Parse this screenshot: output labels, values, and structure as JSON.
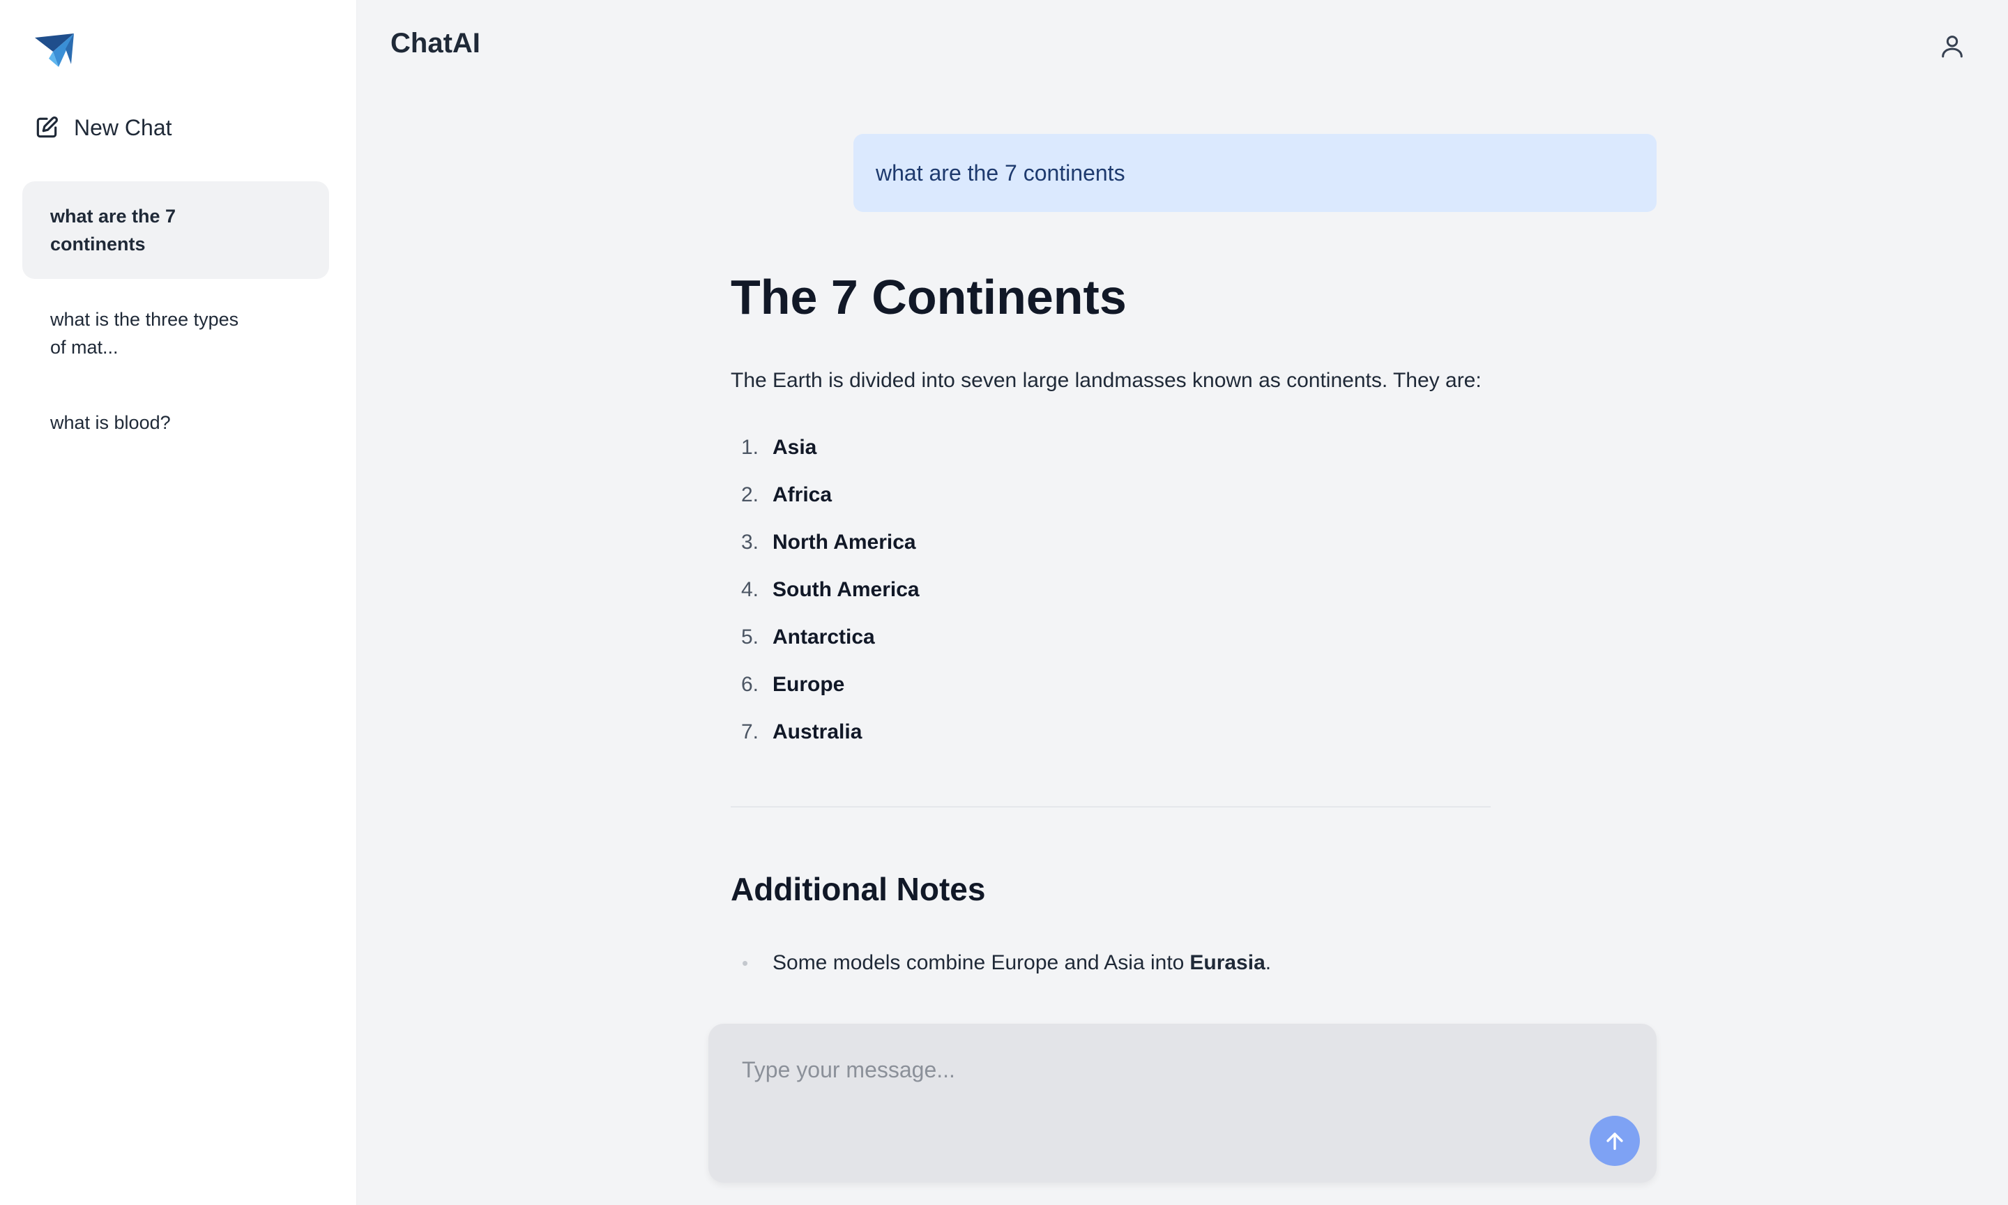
{
  "app": {
    "title": "ChatAI"
  },
  "sidebar": {
    "new_chat_label": "New Chat",
    "history": [
      {
        "label": "what are the 7 continents",
        "active": true
      },
      {
        "label": "what is the three types of mat...",
        "active": false
      },
      {
        "label": "what is blood?",
        "active": false
      }
    ]
  },
  "conversation": {
    "user_message": "what are the 7 continents",
    "answer": {
      "title": "The 7 Continents",
      "intro": "The Earth is divided into seven large landmasses known as continents. They are:",
      "list": [
        {
          "num": "1.",
          "text": "Asia"
        },
        {
          "num": "2.",
          "text": "Africa"
        },
        {
          "num": "3.",
          "text": "North America"
        },
        {
          "num": "4.",
          "text": "South America"
        },
        {
          "num": "5.",
          "text": "Antarctica"
        },
        {
          "num": "6.",
          "text": "Europe"
        },
        {
          "num": "7.",
          "text": "Australia"
        }
      ],
      "notes_title": "Additional Notes",
      "notes": [
        {
          "text": "Some models combine Europe and Asia into ",
          "bold": "Eurasia",
          "suffix": "."
        }
      ]
    }
  },
  "composer": {
    "placeholder": "Type your message..."
  },
  "icons": {
    "logo": "paper-plane-logo-icon",
    "new_chat": "edit-square-icon",
    "user": "user-icon",
    "send": "arrow-up-icon"
  },
  "colors": {
    "user_bubble": "#dbe9fe",
    "send_button": "#7ea2f4",
    "active_history": "#f1f2f4"
  }
}
